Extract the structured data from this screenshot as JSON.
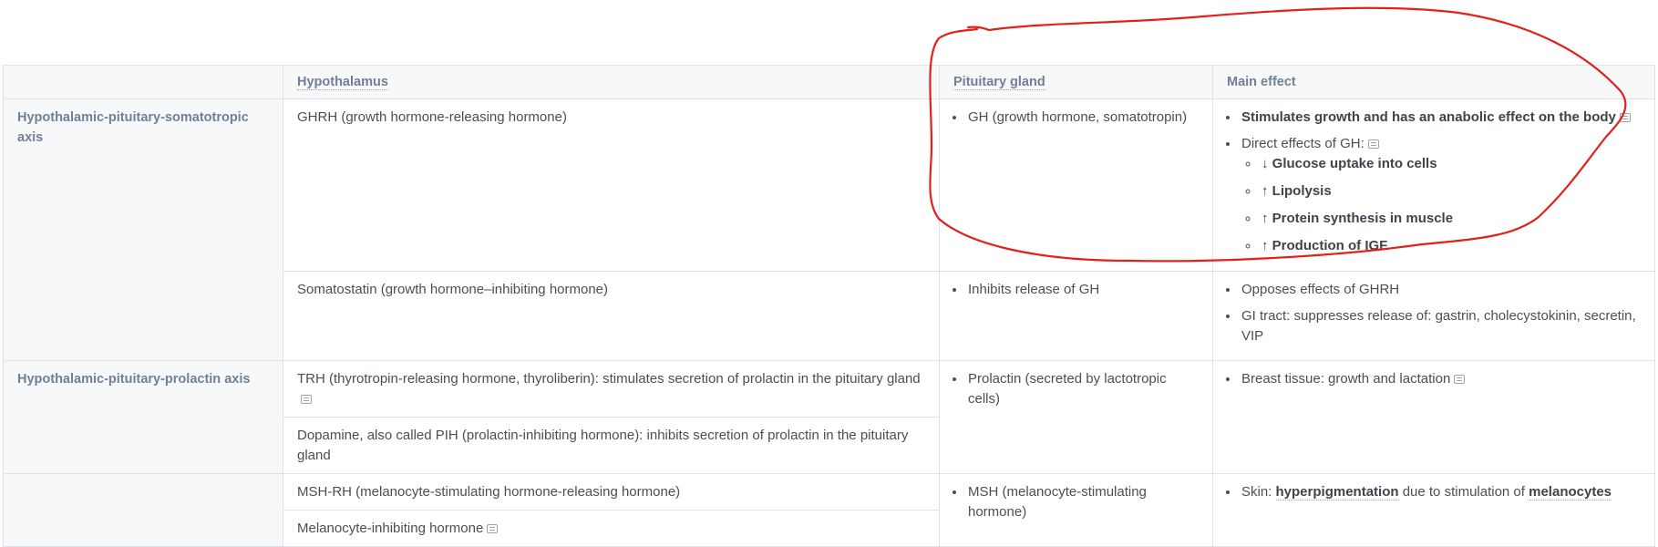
{
  "table": {
    "headers": [
      "",
      "Hypothalamus",
      "Pituitary gland",
      "Main effect"
    ],
    "axis1": {
      "label": "Hypothalamic-pituitary-somatotropic axis",
      "row1": {
        "hypo": "GHRH (growth hormone-releasing hormone)",
        "pit": "GH (growth hormone, somatotropin)",
        "effect1": "Stimulates growth and has an anabolic effect on the body",
        "effect2": "Direct effects of GH:",
        "sub1": "↓ Glucose uptake into cells",
        "sub2": "↑ Lipolysis",
        "sub3": "↑ Protein synthesis in muscle",
        "sub4": "↑ Production of IGF"
      },
      "row2": {
        "hypo": "Somatostatin (growth hormone–inhibiting hormone)",
        "pit": "Inhibits release of GH",
        "effect1": "Opposes effects of GHRH",
        "effect2": "GI tract: suppresses release of: gastrin, cholecystokinin, secretin, VIP"
      }
    },
    "axis2": {
      "label": "Hypothalamic-pituitary-prolactin axis",
      "hypo1": "TRH (thyrotropin-releasing hormone, thyroliberin): stimulates secretion of prolactin in the pituitary gland",
      "hypo2": "Dopamine, also called PIH (prolactin-inhibiting hormone): inhibits secretion of prolactin in the pituitary gland",
      "pit": "Prolactin (secreted by lactotropic cells)",
      "effect": "Breast tissue: growth and lactation"
    },
    "axis3": {
      "label": "",
      "hypo1": "MSH-RH (melanocyte-stimulating hormone-releasing hormone)",
      "hypo2": "Melanocyte-inhibiting hormone",
      "pit": "MSH (melanocyte-stimulating hormone)",
      "effect_prefix": "Skin: ",
      "effect_b1": "hyperpigmentation",
      "effect_mid": " due to stimulation of ",
      "effect_b2": "melanocytes"
    }
  },
  "annotation": {
    "color": "#e3201b"
  }
}
